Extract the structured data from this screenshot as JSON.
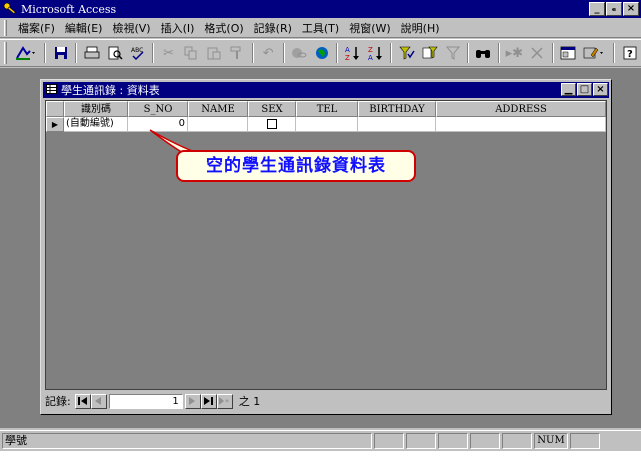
{
  "window": {
    "title": "Microsoft Access",
    "buttons": [
      "_",
      "ₑ",
      "×"
    ]
  },
  "menu": [
    "檔案(F)",
    "編輯(E)",
    "檢視(V)",
    "插入(I)",
    "格式(O)",
    "記錄(R)",
    "工具(T)",
    "視窗(W)",
    "說明(H)"
  ],
  "toolbar": {
    "icons": [
      "design-view-icon",
      "save-icon",
      "print-icon",
      "print-preview-icon",
      "spelling-icon",
      "cut-icon",
      "copy-icon",
      "paste-icon",
      "format-painter-icon",
      "undo-icon",
      "insert-hyperlink-icon",
      "web-toolbar-icon",
      "sort-ascending-icon",
      "sort-descending-icon",
      "filter-by-selection-icon",
      "filter-by-form-icon",
      "apply-filter-icon",
      "find-icon",
      "new-record-icon",
      "delete-record-icon",
      "database-window-icon",
      "new-object-icon",
      "help-icon"
    ]
  },
  "child_window": {
    "title": "學生通訊錄 : 資料表",
    "buttons": [
      "▁",
      "□",
      "×"
    ]
  },
  "table": {
    "columns": [
      "識別碼",
      "S_NO",
      "NAME",
      "SEX",
      "TEL",
      "BIRTHDAY",
      "ADDRESS"
    ],
    "row": {
      "selector": "▶",
      "id": "(自動編號)",
      "s_no": "0",
      "name": "",
      "tel": "",
      "birthday": "",
      "address": ""
    }
  },
  "annotation": {
    "text": "空的學生通訊錄資料表",
    "text_color": "#1010ff",
    "border_color": "#d00000"
  },
  "navigation": {
    "label": "記錄:",
    "current": "1",
    "of_text": "之 1"
  },
  "status": {
    "text": "學號",
    "num": "NUM"
  },
  "colors": {
    "title_bar": "#000080",
    "face": "#c0c0c0",
    "mdi_background": "#808080"
  }
}
